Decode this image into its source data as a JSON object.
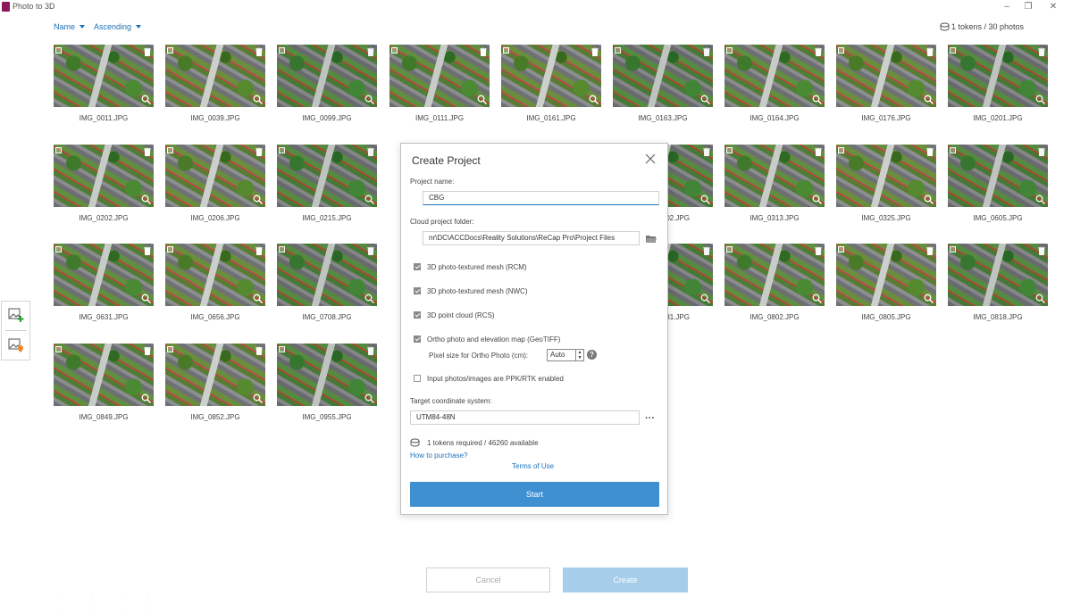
{
  "window": {
    "title": "Photo to 3D"
  },
  "sort": {
    "field": "Name",
    "order": "Ascending"
  },
  "tokens_summary": "1 tokens / 30 photos",
  "photos": [
    "IMG_0011.JPG",
    "IMG_0039.JPG",
    "IMG_0099.JPG",
    "IMG_0111.JPG",
    "IMG_0161.JPG",
    "IMG_0163.JPG",
    "IMG_0164.JPG",
    "IMG_0176.JPG",
    "IMG_0201.JPG",
    "IMG_0202.JPG",
    "IMG_0206.JPG",
    "IMG_0215.JPG",
    "",
    "",
    "IMG_0302.JPG",
    "IMG_0313.JPG",
    "IMG_0325.JPG",
    "IMG_0605.JPG",
    "IMG_0631.JPG",
    "IMG_0656.JPG",
    "IMG_0708.JPG",
    "",
    "",
    "IMG_0781.JPG",
    "IMG_0802.JPG",
    "IMG_0805.JPG",
    "IMG_0818.JPG",
    "IMG_0849.JPG",
    "IMG_0852.JPG",
    "IMG_0955.JPG"
  ],
  "photos_visible_labels": {
    "r2c6": "02.JPG",
    "r3c6": "31.JPG"
  },
  "dialog": {
    "title": "Create Project",
    "project_name_label": "Project name:",
    "project_name_value": "CBG",
    "cloud_folder_label": "Cloud project folder:",
    "cloud_folder_value": "nr\\DC\\ACCDocs\\Reality Solutions\\ReCap Pro\\Project Files",
    "options": [
      {
        "label": "3D photo-textured mesh (RCM)",
        "checked": true
      },
      {
        "label": "3D photo-textured mesh (NWC)",
        "checked": true
      },
      {
        "label": "3D point cloud (RCS)",
        "checked": true
      },
      {
        "label": "Ortho photo and elevation map (GeoTIFF)",
        "checked": true
      }
    ],
    "pixel_size_label": "Pixel size for Ortho Photo (cm):",
    "pixel_size_value": "Auto",
    "ppk_label": "Input photos/images are PPK/RTK enabled",
    "ppk_checked": false,
    "coord_label": "Target coordinate system:",
    "coord_value": "UTM84-48N",
    "tokens_required": "1 tokens required / 46260 available",
    "how_to_purchase": "How to purchase?",
    "terms": "Terms of Use",
    "start_label": "Start"
  },
  "footer": {
    "cancel_label": "Cancel",
    "create_label": "Create"
  },
  "colors": {
    "accent": "#3f90d1",
    "link": "#1e72b8",
    "create_disabled": "#a6cde9"
  }
}
